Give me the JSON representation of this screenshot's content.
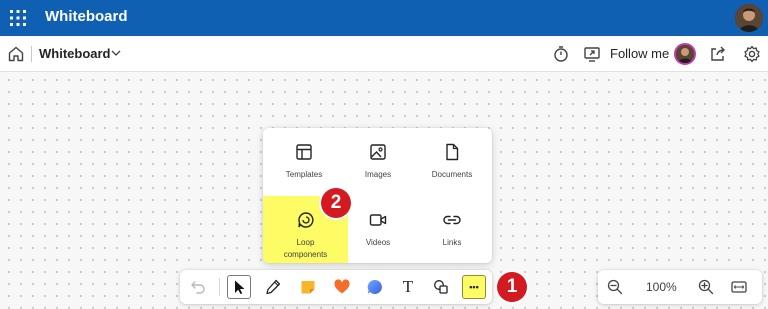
{
  "app": {
    "title": "Whiteboard",
    "brand_color": "#0f5fb3"
  },
  "command_bar": {
    "document_title": "Whiteboard",
    "follow_label": "Follow me",
    "icons": [
      "home-icon",
      "chevron-down-icon",
      "timer-icon",
      "present-icon",
      "avatar",
      "share-icon",
      "settings-icon"
    ]
  },
  "insert_menu": {
    "items": [
      {
        "label": "Templates",
        "icon": "templates-icon"
      },
      {
        "label": "Images",
        "icon": "image-icon"
      },
      {
        "label": "Documents",
        "icon": "document-icon"
      },
      {
        "label": "Loop components",
        "icon": "loop-icon",
        "highlighted": true
      },
      {
        "label": "Videos",
        "icon": "video-icon"
      },
      {
        "label": "Links",
        "icon": "link-icon"
      }
    ],
    "highlight_color": "#fdfc65"
  },
  "callouts": {
    "badge_1": "1",
    "badge_2": "2",
    "color": "#d21a20"
  },
  "toolbar": {
    "tools": [
      "undo-icon",
      "select-icon",
      "pen-icon",
      "sticky-note-icon",
      "reaction-icon",
      "comment-icon",
      "text-icon",
      "shapes-icon",
      "more-icon"
    ],
    "text_tool_glyph": "T",
    "more_glyph": "•••"
  },
  "zoom": {
    "level": "100%",
    "icons": [
      "zoom-out-icon",
      "zoom-in-icon",
      "fit-to-screen-icon"
    ]
  }
}
